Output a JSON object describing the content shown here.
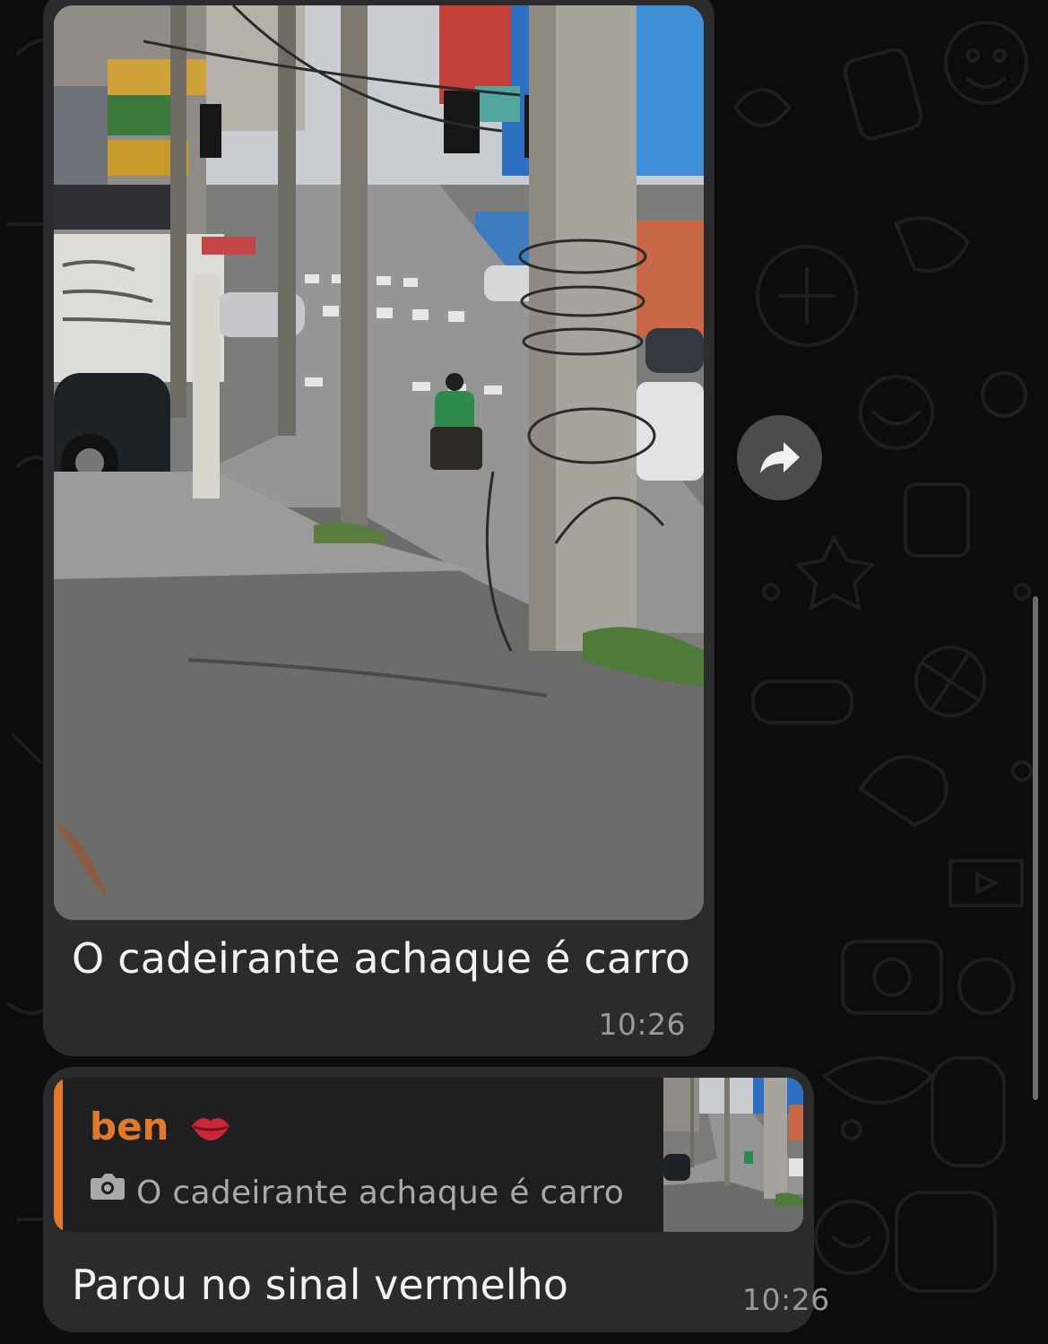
{
  "messages": [
    {
      "type": "photo",
      "caption": "O cadeirante achaque é carro",
      "time": "10:26"
    },
    {
      "type": "reply",
      "quoted": {
        "sender": "ben",
        "sender_emoji": "💋",
        "text": "O cadeirante achaque é carro",
        "media_icon": "camera-icon",
        "accent_color": "#e07a2a"
      },
      "text": "Parou no sinal vermelho",
      "time": "10:26"
    }
  ],
  "actions": {
    "forward_icon": "forward-arrow-icon"
  },
  "theme": {
    "bubble_color": "#2b2b2d",
    "background": "#0c0c0d",
    "reply_accent": "#e07a2a",
    "time_color": "#9a9a9c"
  }
}
